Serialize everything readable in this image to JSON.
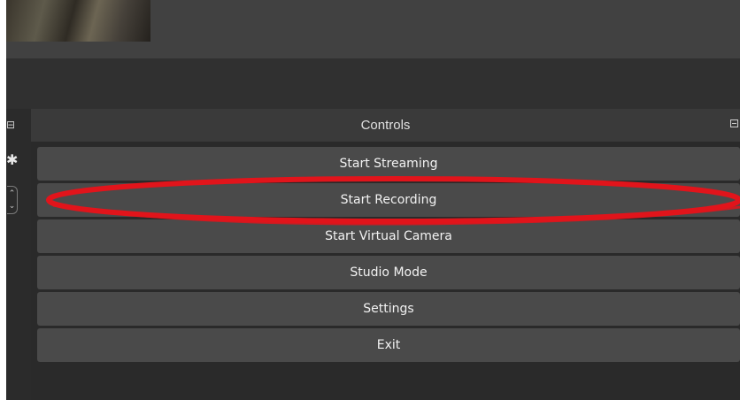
{
  "controls": {
    "title": "Controls",
    "buttons": [
      {
        "label": "Start Streaming"
      },
      {
        "label": "Start Recording"
      },
      {
        "label": "Start Virtual Camera"
      },
      {
        "label": "Studio Mode"
      },
      {
        "label": "Settings"
      },
      {
        "label": "Exit"
      }
    ]
  },
  "icons": {
    "dock_float": "dock-float-icon",
    "gear": "gear-icon",
    "scroll": "scroll-arrows-icon"
  },
  "colors": {
    "panel_bg": "#2a2a2a",
    "button_bg": "#4a4a4a",
    "annotation": "#e1141b"
  },
  "annotation": {
    "target": "Start Recording"
  }
}
